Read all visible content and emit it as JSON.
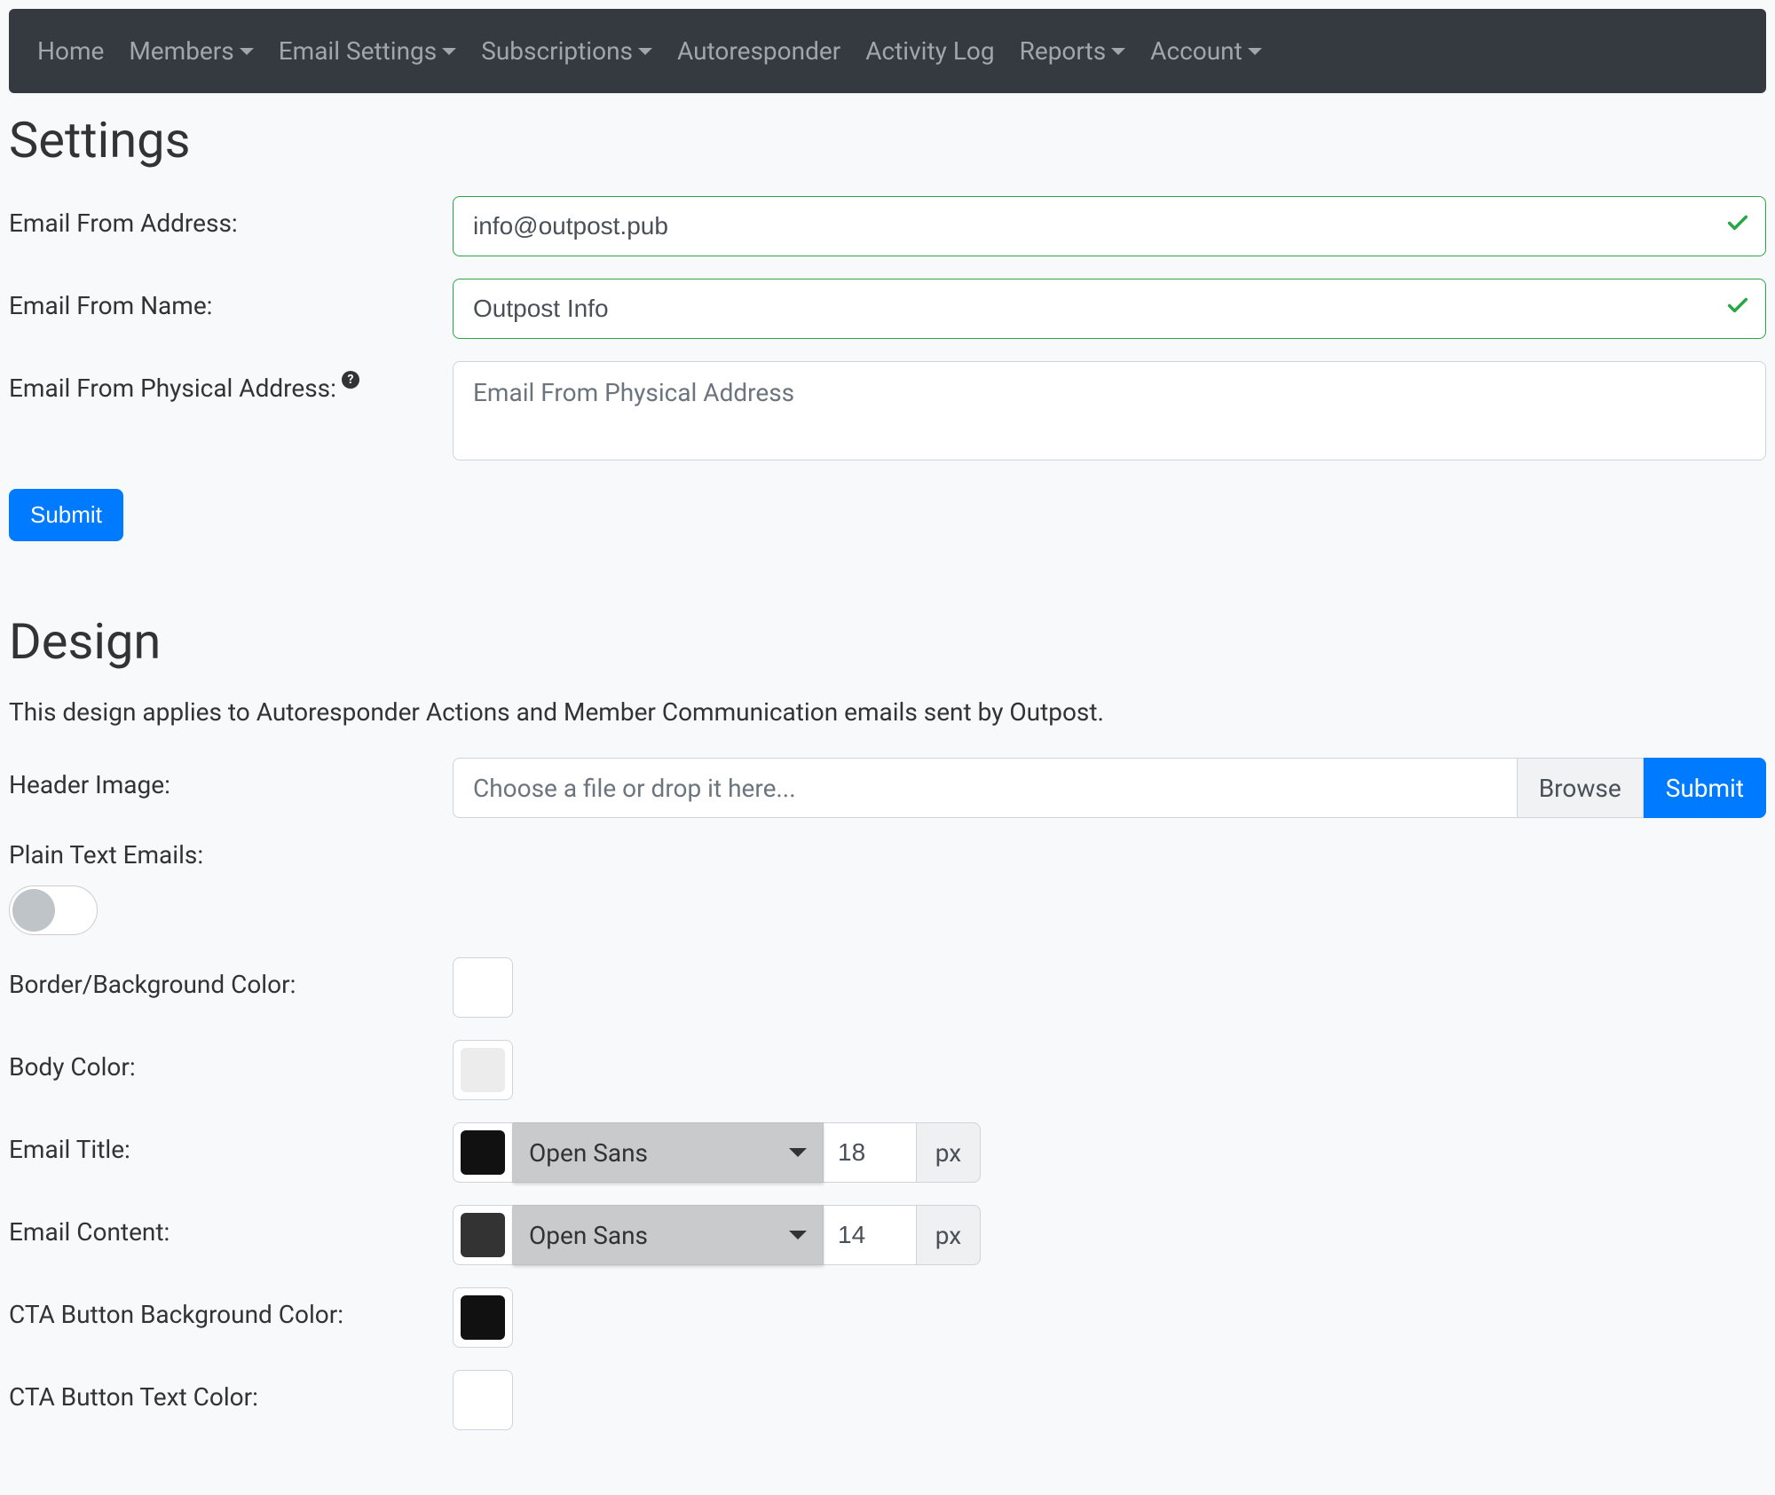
{
  "nav": {
    "home": "Home",
    "members": "Members",
    "email_settings": "Email Settings",
    "subscriptions": "Subscriptions",
    "autoresponder": "Autoresponder",
    "activity_log": "Activity Log",
    "reports": "Reports",
    "account": "Account"
  },
  "settings": {
    "heading": "Settings",
    "from_address_label": "Email From Address:",
    "from_address_value": "info@outpost.pub",
    "from_name_label": "Email From Name:",
    "from_name_value": "Outpost Info",
    "physical_label": "Email From Physical Address:",
    "physical_placeholder": "Email From Physical Address",
    "submit": "Submit"
  },
  "design": {
    "heading": "Design",
    "subtitle": "This design applies to Autoresponder Actions and Member Communication emails sent by Outpost.",
    "header_image_label": "Header Image:",
    "file_placeholder": "Choose a file or drop it here...",
    "browse": "Browse",
    "submit": "Submit",
    "plain_text_label": "Plain Text Emails:",
    "border_bg_label": "Border/Background Color:",
    "border_bg_color": "#ffffff",
    "body_color_label": "Body Color:",
    "body_color": "#ececec",
    "email_title_label": "Email Title:",
    "email_title_color": "#111111",
    "email_title_font": "Open Sans",
    "email_title_size": "18",
    "email_content_label": "Email Content:",
    "email_content_color": "#333333",
    "email_content_font": "Open Sans",
    "email_content_size": "14",
    "cta_bg_label": "CTA Button Background Color:",
    "cta_bg_color": "#111111",
    "cta_text_label": "CTA Button Text Color:",
    "cta_text_color": "#ffffff",
    "unit": "px"
  }
}
